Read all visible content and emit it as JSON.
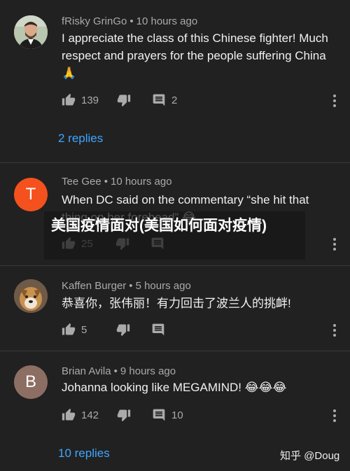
{
  "comments": [
    {
      "author": "fRisky GrinGo",
      "time": "10 hours ago",
      "text": "I appreciate the class of this Chinese fighter! Much respect and prayers for the people suffering China 🙏",
      "likes": "139",
      "replies": "2",
      "view_replies": "2 replies",
      "avatar": {
        "type": "photo",
        "bg": "#b9c6b0"
      }
    },
    {
      "author": "Tee Gee",
      "time": "10 hours ago",
      "text": "When DC said on the commentary “she hit that thing on her forehead” 😂",
      "likes": "25",
      "avatar": {
        "type": "letter",
        "letter": "T",
        "bg": "#f4511e"
      }
    },
    {
      "author": "Kaffen Burger",
      "time": "5 hours ago",
      "text": "恭喜你，张伟丽！有力回击了波兰人的挑衅!",
      "likes": "5",
      "avatar": {
        "type": "photo",
        "bg": "#8a6a4f"
      }
    },
    {
      "author": "Brian Avila",
      "time": "9 hours ago",
      "text": "Johanna looking like MEGAMIND! 😂😂😂",
      "likes": "142",
      "replies": "10",
      "view_replies": "10 replies",
      "avatar": {
        "type": "letter",
        "letter": "B",
        "bg": "#8d6e63"
      }
    }
  ],
  "separator": "•",
  "overlay_title": "美国疫情面对(美国如何面对疫情)",
  "watermark": "知乎 @Doug",
  "colors": {
    "background": "#212121",
    "link": "#3ea6ff",
    "meta": "#aaaaaa"
  },
  "icons": [
    "thumb-up-icon",
    "thumb-down-icon",
    "reply-icon",
    "more-vert-icon"
  ]
}
